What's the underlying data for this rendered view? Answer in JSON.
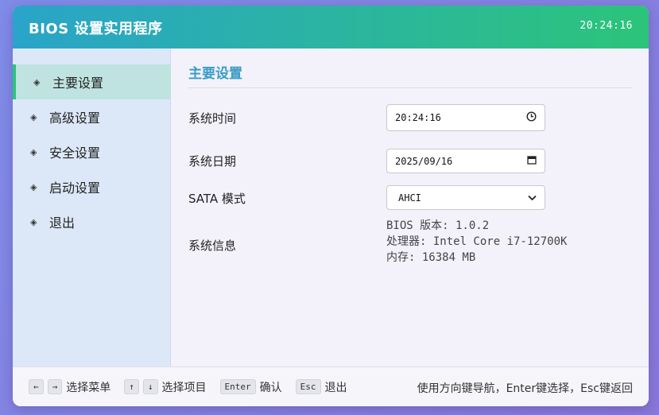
{
  "window": {
    "title": "BIOS 设置实用程序",
    "clock": "20:24:16"
  },
  "sidebar": {
    "items": [
      {
        "label": "主要设置",
        "active": true
      },
      {
        "label": "高级设置",
        "active": false
      },
      {
        "label": "安全设置",
        "active": false
      },
      {
        "label": "启动设置",
        "active": false
      },
      {
        "label": "退出",
        "active": false
      }
    ],
    "bullet": "◈"
  },
  "main": {
    "section_title": "主要设置",
    "rows": {
      "time_label": "系统时间",
      "time_value": "20:24:16",
      "date_label": "系统日期",
      "date_value": "2025/09/16",
      "sata_label": "SATA 模式",
      "sata_value": "AHCI",
      "info_label": "系统信息",
      "info_lines": [
        "BIOS 版本: 1.0.2",
        "处理器: Intel Core i7-12700K",
        "内存: 16384 MB"
      ]
    }
  },
  "footer": {
    "hints": [
      {
        "keys": [
          "←",
          "→"
        ],
        "label": "选择菜单"
      },
      {
        "keys": [
          "↑",
          "↓"
        ],
        "label": "选择项目"
      },
      {
        "keys": [
          "Enter"
        ],
        "label": "确认"
      },
      {
        "keys": [
          "Esc"
        ],
        "label": "退出"
      }
    ],
    "right_text": "使用方向键导航，Enter键选择，Esc键返回"
  },
  "colors": {
    "accent": "#3a9cc7",
    "header_start": "#2aa4c9",
    "header_end": "#2cc47a",
    "active_bg": "#bfe3e0"
  }
}
